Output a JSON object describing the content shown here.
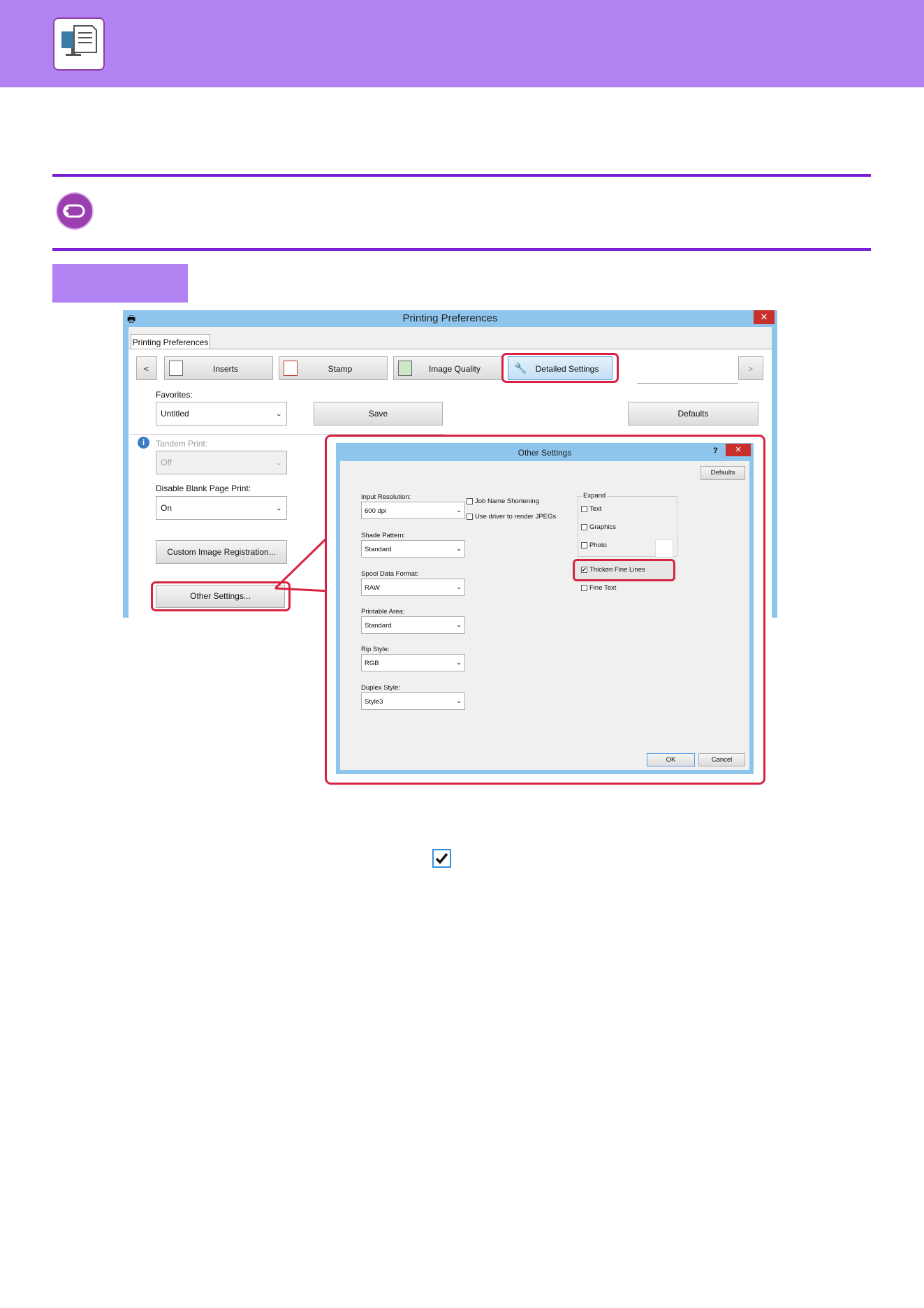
{
  "printing_preferences": {
    "title": "Printing Preferences",
    "close": "✕",
    "tab": "Printing Preferences",
    "nav_prev": "<",
    "nav_next": ">",
    "tabs": [
      "Inserts",
      "Stamp",
      "Image Quality",
      "Detailed Settings"
    ],
    "favorites_label": "Favorites:",
    "favorites_value": "Untitled",
    "save": "Save",
    "defaults": "Defaults",
    "tandem_label": "Tandem Print:",
    "tandem_value": "Off",
    "blank_label": "Disable Blank Page Print:",
    "blank_value": "On",
    "custom_image": "Custom Image Registration...",
    "other_settings": "Other Settings..."
  },
  "other_settings": {
    "title": "Other Settings",
    "help": "?",
    "close": "✕",
    "defaults": "Defaults",
    "input_resolution_label": "Input Resolution:",
    "input_resolution_value": "600 dpi",
    "shade_pattern_label": "Shade Pattern:",
    "shade_pattern_value": "Standard",
    "spool_label": "Spool Data Format:",
    "spool_value": "RAW",
    "printable_label": "Printable Area:",
    "printable_value": "Standard",
    "rip_label": "Rip Style:",
    "rip_value": "RGB",
    "duplex_label": "Duplex Style:",
    "duplex_value": "Style3",
    "job_name": "Job Name Shortening",
    "use_driver": "Use driver to render JPEGs",
    "expand_label": "Expand",
    "text": "Text",
    "graphics": "Graphics",
    "photo": "Photo",
    "thicken": "Thicken Fine Lines",
    "fine_text": "Fine Text",
    "ok": "OK",
    "cancel": "Cancel"
  },
  "icons": {
    "header": "computer-document-icon",
    "back": "return-arrow-icon",
    "check": "checkmark-icon"
  },
  "colors": {
    "header_bg": "#b182f2",
    "rule": "#7a1fd6",
    "highlight": "#d62343",
    "titlebar": "#8ec5ed"
  }
}
